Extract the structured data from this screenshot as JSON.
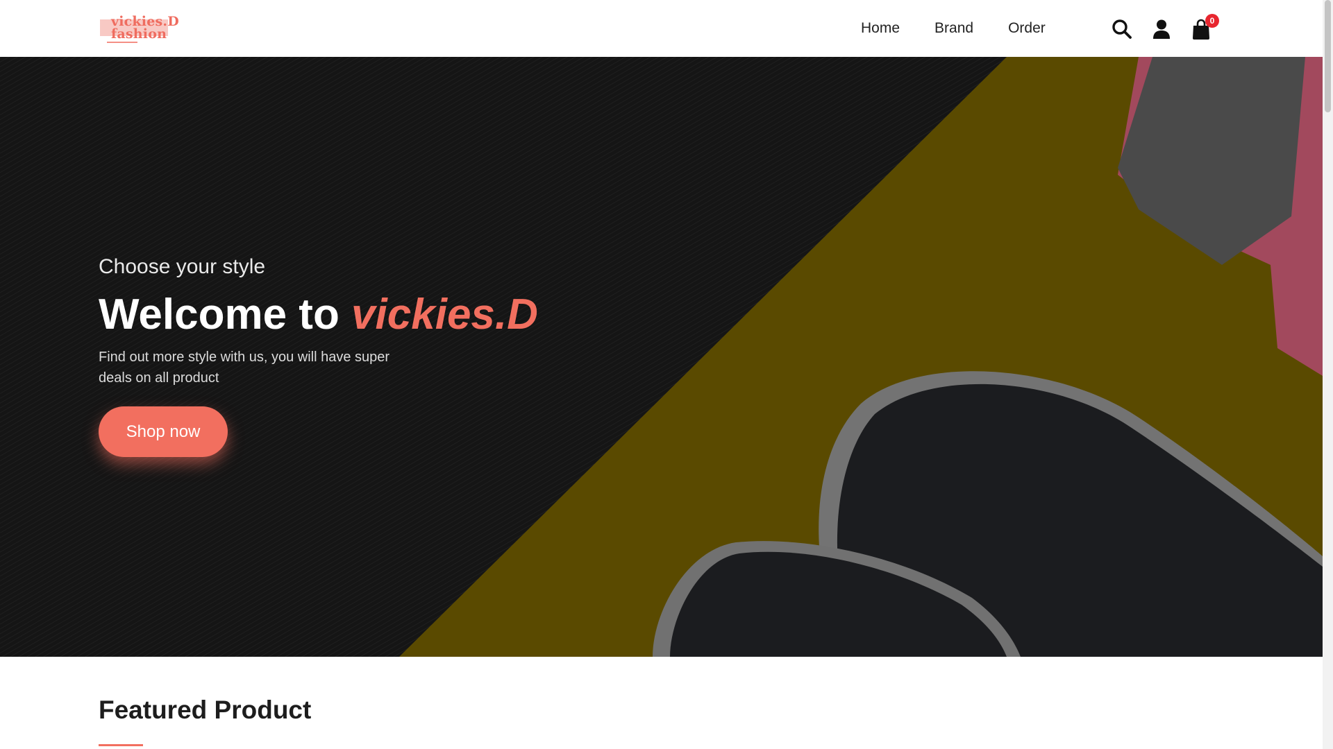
{
  "header": {
    "logo_text_line1": "vickies.D",
    "logo_text_line2": "fashion",
    "nav": [
      "Home",
      "Brand",
      "Order"
    ],
    "icons": [
      "search-icon",
      "user-icon",
      "shopping-bag-icon"
    ],
    "cart_count": "0"
  },
  "hero": {
    "subtitle": "Choose your style",
    "title_prefix": "Welcome to",
    "title_brand": "vickies.D",
    "description": "Find out more style with us, you will have super deals on all product",
    "cta_label": "Shop now"
  },
  "featured": {
    "title": "Featured Product"
  },
  "colors": {
    "accent": "#f26f5f",
    "badge": "#e8262f",
    "hero_yellow": "#e0b416",
    "hero_dark": "#1b1b1b"
  }
}
